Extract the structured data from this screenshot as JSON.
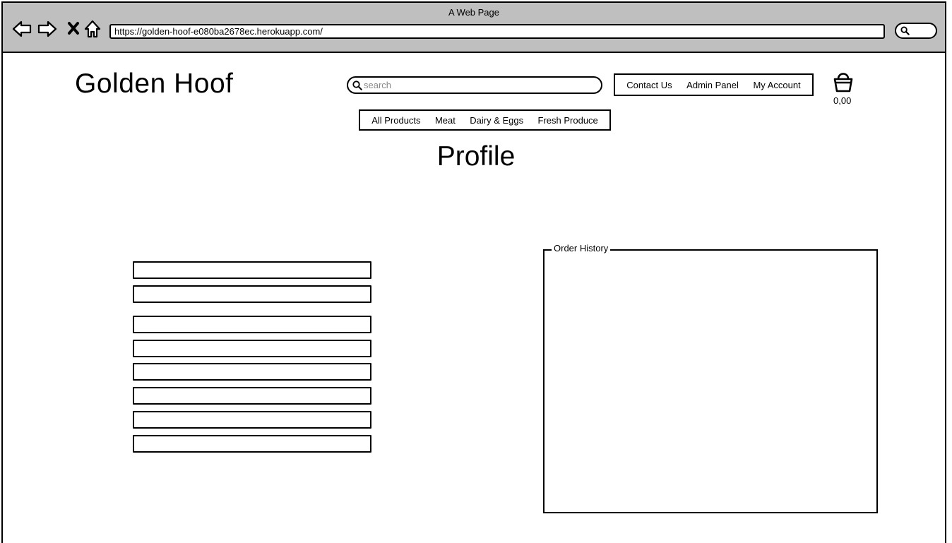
{
  "browser": {
    "window_title": "A Web Page",
    "url": "https://golden-hoof-e080ba2678ec.herokuapp.com/",
    "icons": [
      "back-arrow-icon",
      "forward-arrow-icon",
      "close-icon",
      "home-icon",
      "search-icon"
    ]
  },
  "header": {
    "brand": "Golden Hoof",
    "search": {
      "placeholder": "search",
      "value": ""
    },
    "top_nav": [
      "Contact Us",
      "Admin Panel",
      "My Account"
    ],
    "cart": {
      "icon": "basket-icon",
      "total": "0,00"
    },
    "category_nav": [
      "All Products",
      "Meat",
      "Dairy & Eggs",
      "Fresh Produce"
    ]
  },
  "main": {
    "page_title": "Profile",
    "order_history": {
      "legend": "Order History"
    }
  }
}
